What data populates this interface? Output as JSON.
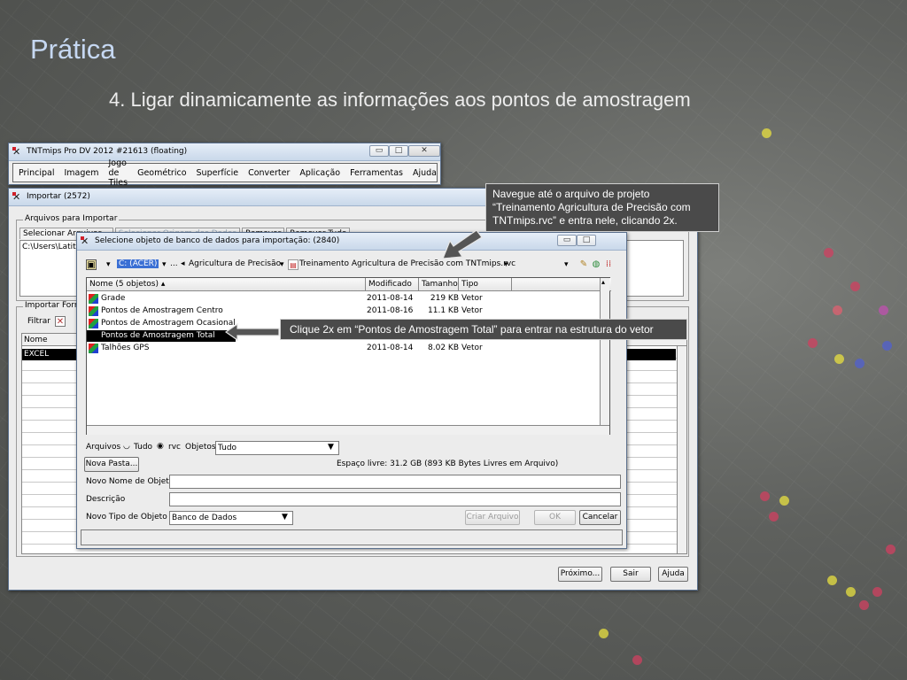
{
  "slide": {
    "title": "Prática",
    "subtitle": "4. Ligar dinamicamente as informações aos pontos de amostragem"
  },
  "main_window": {
    "title": "TNTmips Pro DV 2012  #21613 (floating)",
    "menu": [
      "Principal",
      "Imagem",
      "Jogo de Tiles",
      "Geométrico",
      "Superfície",
      "Converter",
      "Aplicação",
      "Ferramentas",
      "Ajuda"
    ]
  },
  "import_window": {
    "title": "Importar (2572)",
    "group_files": "Arquivos para Importar",
    "tab_select": "Selecionar Arquivos...",
    "tab_dup": "Selecionar Origem dos Dados",
    "tab_remove": "Remover",
    "tab_remove_all": "Remover Tudo",
    "path": "C:\\Users\\Latitu",
    "group_format": "Importar Formato",
    "filter_label": "Filtrar",
    "col_name": "Nome",
    "row_first": "EXCEL",
    "btn_next": "Próximo...",
    "btn_exit": "Sair",
    "btn_help": "Ajuda"
  },
  "select_dialog": {
    "title": "Selecione objeto de banco de dados para importação: (2840)",
    "breadcrumb": {
      "drive": "C: (ACER)",
      "ellipsis": "...",
      "folder": "Agricultura de Precisão",
      "project": "Treinamento Agricultura de Precisão com TNTmips.rvc"
    },
    "columns": {
      "name": "Nome  (5 objetos)",
      "modified": "Modificado",
      "size": "Tamanho",
      "type": "Tipo"
    },
    "rows": [
      {
        "name": "Grade",
        "modified": "2011-08-14",
        "size": "219 KB",
        "type": "Vetor"
      },
      {
        "name": "Pontos de Amostragem Centro",
        "modified": "2011-08-16",
        "size": "11.1 KB",
        "type": "Vetor"
      },
      {
        "name": "Pontos de Amostragem Ocasional",
        "modified": "",
        "size": "",
        "type": ""
      },
      {
        "name": "Pontos de Amostragem Total",
        "modified": "",
        "size": "",
        "type": ""
      },
      {
        "name": "Talhões GPS",
        "modified": "2011-08-14",
        "size": "8.02 KB",
        "type": "Vetor"
      }
    ],
    "files_label": "Arquivos",
    "radio_all": "Tudo",
    "radio_rvc": "rvc",
    "objects_label": "Objetos",
    "objects_value": "Tudo",
    "btn_new_folder": "Nova Pasta...",
    "free_space": "Espaço livre: 31.2 GB  (893 KB Bytes Livres em Arquivo)",
    "new_name_label": "Novo Nome de Objeto",
    "description_label": "Descrição",
    "new_type_label": "Novo Tipo de Objeto",
    "new_type_value": "Banco de Dados",
    "btn_create": "Criar Arquivo",
    "btn_ok": "OK",
    "btn_cancel": "Cancelar"
  },
  "callouts": {
    "navigate": "Navegue até o arquivo de projeto “Treinamento Agricultura de Precisão com TNTmips.rvc” e entra nele, clicando 2x.",
    "double_click": "Clique 2x em “Pontos de Amostragem Total”  para entrar na estrutura do vetor"
  },
  "colors": {
    "title_blue": "#c6d8f2",
    "callout_bg": "#4a4a4a",
    "selection": "#000000"
  }
}
